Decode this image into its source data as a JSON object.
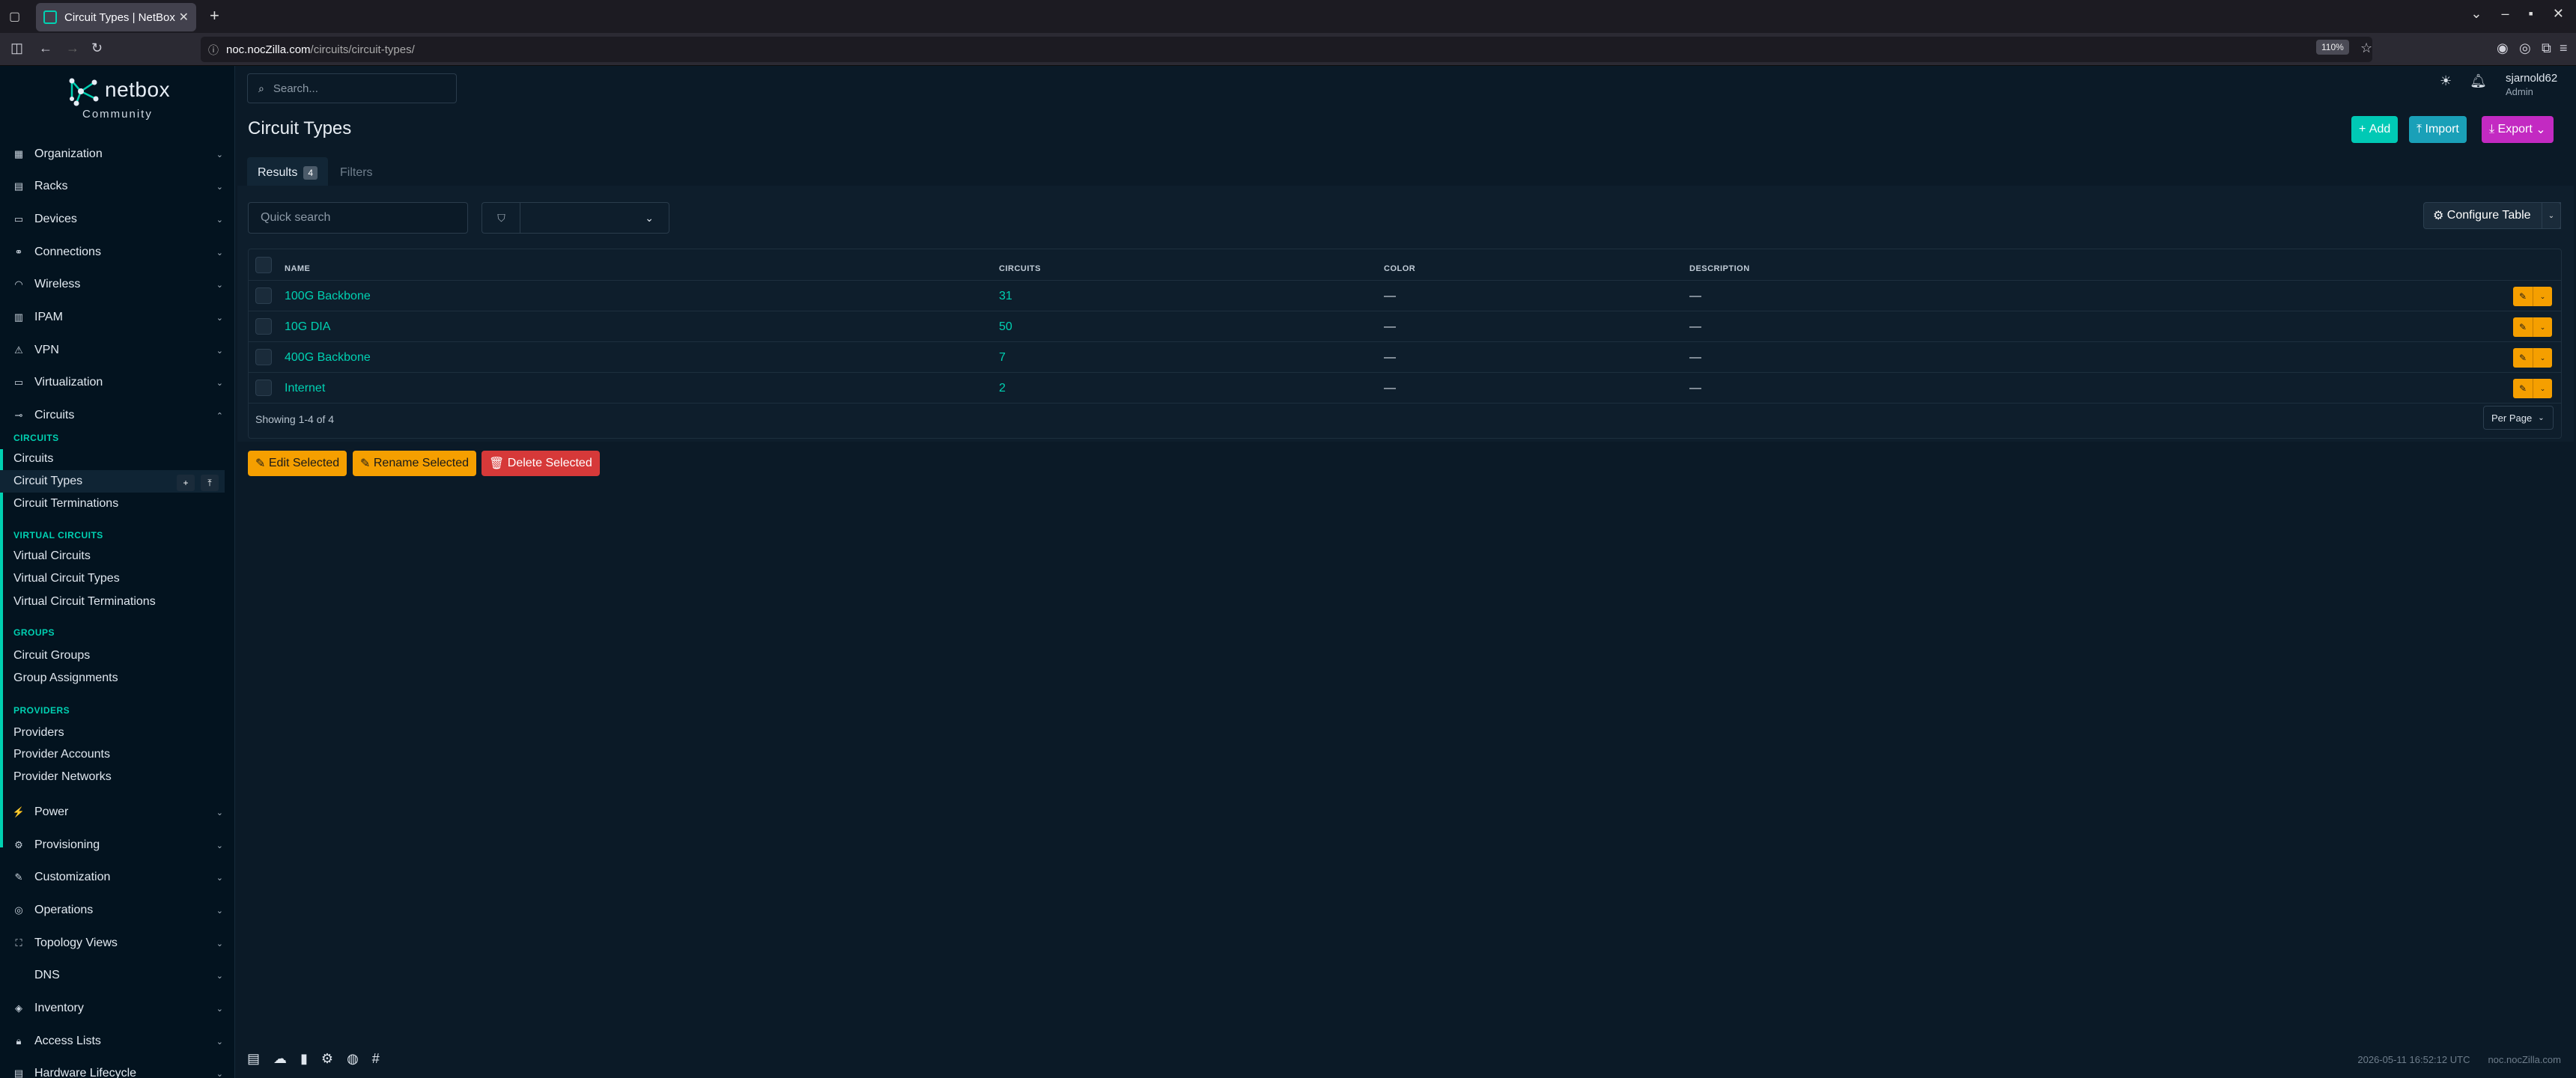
{
  "browser": {
    "tab_title": "Circuit Types | NetBox",
    "url_host": "noc.nocZilla.com",
    "url_path": "/circuits/circuit-types/",
    "zoom": "110%"
  },
  "brand": {
    "name": "netbox",
    "edition": "Community"
  },
  "sidebar": {
    "menus_top": [
      {
        "label": "Organization",
        "icon": "building-icon"
      },
      {
        "label": "Racks",
        "icon": "rack-icon"
      },
      {
        "label": "Devices",
        "icon": "server-icon"
      },
      {
        "label": "Connections",
        "icon": "connection-icon"
      },
      {
        "label": "Wireless",
        "icon": "wifi-icon"
      },
      {
        "label": "IPAM",
        "icon": "ipam-icon"
      },
      {
        "label": "VPN",
        "icon": "vpn-icon"
      },
      {
        "label": "Virtualization",
        "icon": "monitor-icon"
      },
      {
        "label": "Circuits",
        "icon": "circuit-icon"
      }
    ],
    "circuits_section": {
      "heading_circuits": "CIRCUITS",
      "circuits": "Circuits",
      "circuit_types": "Circuit Types",
      "circuit_terminations": "Circuit Terminations",
      "heading_virtual": "VIRTUAL CIRCUITS",
      "virtual_circuits": "Virtual Circuits",
      "virtual_circuit_types": "Virtual Circuit Types",
      "virtual_circuit_terminations": "Virtual Circuit Terminations",
      "heading_groups": "GROUPS",
      "circuit_groups": "Circuit Groups",
      "group_assignments": "Group Assignments",
      "heading_providers": "PROVIDERS",
      "providers": "Providers",
      "provider_accounts": "Provider Accounts",
      "provider_networks": "Provider Networks"
    },
    "menus_bottom": [
      {
        "label": "Power",
        "icon": "power-icon"
      },
      {
        "label": "Provisioning",
        "icon": "provisioning-icon"
      },
      {
        "label": "Customization",
        "icon": "customization-icon"
      },
      {
        "label": "Operations",
        "icon": "operations-icon"
      },
      {
        "label": "Topology Views",
        "icon": "topology-icon"
      },
      {
        "label": "DNS",
        "icon": "dns-icon"
      },
      {
        "label": "Inventory",
        "icon": "inventory-icon"
      },
      {
        "label": "Access Lists",
        "icon": "lock-icon"
      },
      {
        "label": "Hardware Lifecycle",
        "icon": "lifecycle-icon"
      }
    ]
  },
  "header": {
    "search_placeholder": "Search...",
    "user_name": "sjarnold62",
    "user_role": "Admin"
  },
  "page": {
    "title": "Circuit Types",
    "add_label": "Add",
    "import_label": "Import",
    "export_label": "Export",
    "tab_results": "Results",
    "results_count": "4",
    "tab_filters": "Filters",
    "quick_search_placeholder": "Quick search",
    "configure_table": "Configure Table",
    "showing": "Showing 1-4 of 4",
    "per_page": "Per Page",
    "edit_selected": "Edit Selected",
    "rename_selected": "Rename Selected",
    "delete_selected": "Delete Selected"
  },
  "table": {
    "headers": {
      "name": "NAME",
      "circuits": "CIRCUITS",
      "color": "COLOR",
      "description": "DESCRIPTION"
    },
    "rows": [
      {
        "name": "100G Backbone",
        "circuits": "31",
        "color": "—",
        "description": "—"
      },
      {
        "name": "10G DIA",
        "circuits": "50",
        "color": "—",
        "description": "—"
      },
      {
        "name": "400G Backbone",
        "circuits": "7",
        "color": "—",
        "description": "—"
      },
      {
        "name": "Internet",
        "circuits": "2",
        "color": "—",
        "description": "—"
      }
    ]
  },
  "footer": {
    "timestamp": "2026-05-11 16:52:12 UTC",
    "host": "noc.nocZilla.com"
  },
  "colors": {
    "accent": "#00d1b2",
    "add": "#00c9b5",
    "import": "#1aa0b8",
    "export": "#c32ac2",
    "warning": "#f59f00",
    "danger": "#d63939"
  }
}
